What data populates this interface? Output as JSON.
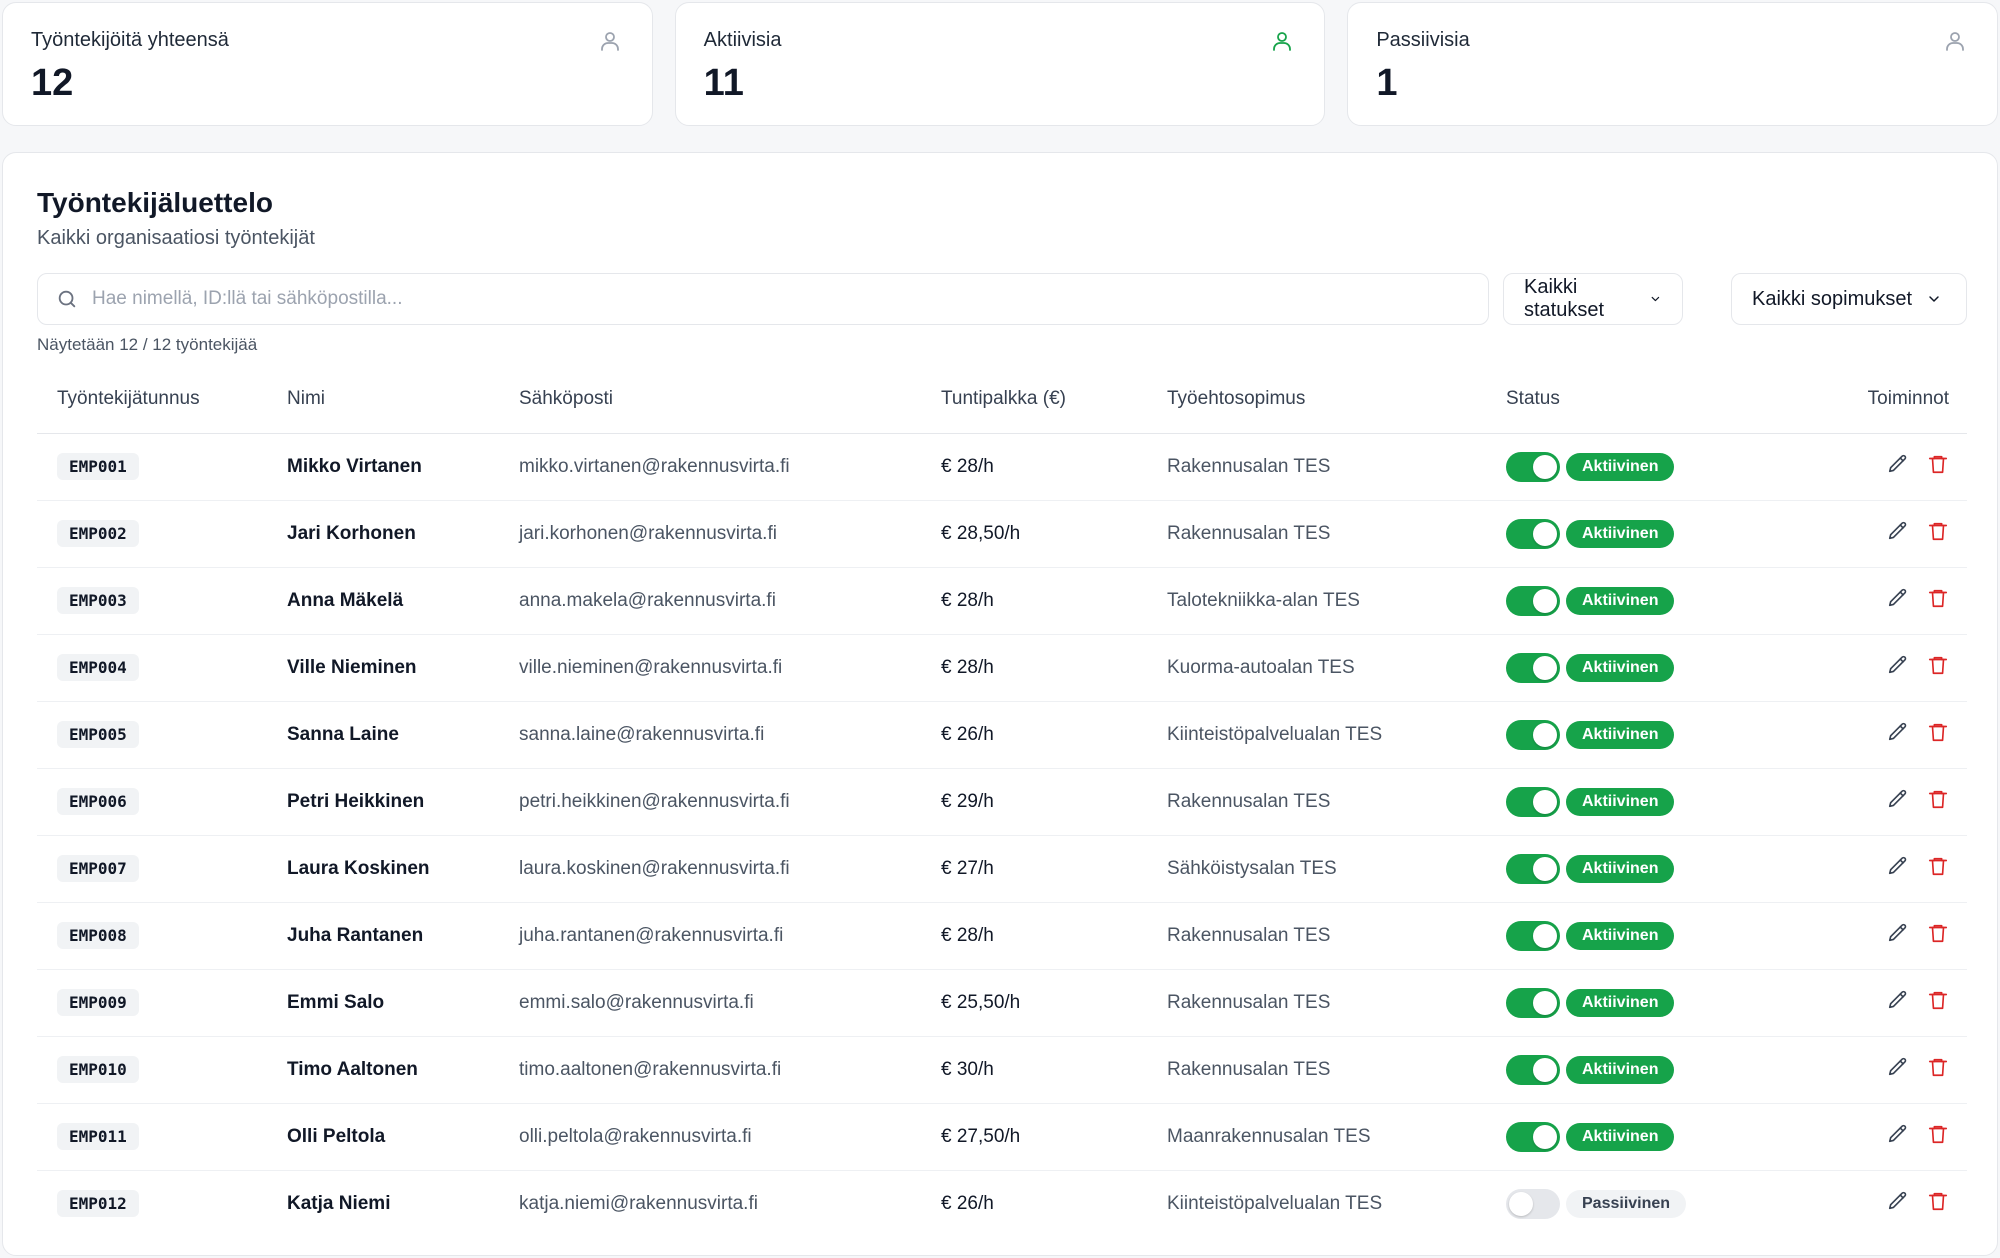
{
  "stats": [
    {
      "title": "Työntekijöitä yhteensä",
      "value": "12",
      "icon": "user-icon",
      "icon_color": "#9ca3af"
    },
    {
      "title": "Aktiivisia",
      "value": "11",
      "icon": "user-icon",
      "icon_color": "#16a34a"
    },
    {
      "title": "Passiivisia",
      "value": "1",
      "icon": "user-icon",
      "icon_color": "#9ca3af"
    }
  ],
  "panel": {
    "title": "Työntekijäluettelo",
    "subtitle": "Kaikki organisaatiosi työntekijät"
  },
  "search": {
    "placeholder": "Hae nimellä, ID:llä tai sähköpostilla...",
    "value": ""
  },
  "filters": {
    "status_label": "Kaikki statukset",
    "contract_label": "Kaikki sopimukset"
  },
  "count_text": "Näytetään 12 / 12 työntekijää",
  "columns": [
    "Työntekijätunnus",
    "Nimi",
    "Sähköposti",
    "Tuntipalkka (€)",
    "Työehtosopimus",
    "Status",
    "Toiminnot"
  ],
  "employees": [
    {
      "id": "EMP001",
      "name": "Mikko Virtanen",
      "email": "mikko.virtanen@rakennusvirta.fi",
      "wage": "€ 28/h",
      "tes": "Rakennusalan TES",
      "active": true,
      "status": "Aktiivinen"
    },
    {
      "id": "EMP002",
      "name": "Jari Korhonen",
      "email": "jari.korhonen@rakennusvirta.fi",
      "wage": "€ 28,50/h",
      "tes": "Rakennusalan TES",
      "active": true,
      "status": "Aktiivinen"
    },
    {
      "id": "EMP003",
      "name": "Anna Mäkelä",
      "email": "anna.makela@rakennusvirta.fi",
      "wage": "€ 28/h",
      "tes": "Talotekniikka-alan TES",
      "active": true,
      "status": "Aktiivinen"
    },
    {
      "id": "EMP004",
      "name": "Ville Nieminen",
      "email": "ville.nieminen@rakennusvirta.fi",
      "wage": "€ 28/h",
      "tes": "Kuorma-autoalan TES",
      "active": true,
      "status": "Aktiivinen"
    },
    {
      "id": "EMP005",
      "name": "Sanna Laine",
      "email": "sanna.laine@rakennusvirta.fi",
      "wage": "€ 26/h",
      "tes": "Kiinteistöpalvelualan TES",
      "active": true,
      "status": "Aktiivinen"
    },
    {
      "id": "EMP006",
      "name": "Petri Heikkinen",
      "email": "petri.heikkinen@rakennusvirta.fi",
      "wage": "€ 29/h",
      "tes": "Rakennusalan TES",
      "active": true,
      "status": "Aktiivinen"
    },
    {
      "id": "EMP007",
      "name": "Laura Koskinen",
      "email": "laura.koskinen@rakennusvirta.fi",
      "wage": "€ 27/h",
      "tes": "Sähköistysalan TES",
      "active": true,
      "status": "Aktiivinen"
    },
    {
      "id": "EMP008",
      "name": "Juha Rantanen",
      "email": "juha.rantanen@rakennusvirta.fi",
      "wage": "€ 28/h",
      "tes": "Rakennusalan TES",
      "active": true,
      "status": "Aktiivinen"
    },
    {
      "id": "EMP009",
      "name": "Emmi Salo",
      "email": "emmi.salo@rakennusvirta.fi",
      "wage": "€ 25,50/h",
      "tes": "Rakennusalan TES",
      "active": true,
      "status": "Aktiivinen"
    },
    {
      "id": "EMP010",
      "name": "Timo Aaltonen",
      "email": "timo.aaltonen@rakennusvirta.fi",
      "wage": "€ 30/h",
      "tes": "Rakennusalan TES",
      "active": true,
      "status": "Aktiivinen"
    },
    {
      "id": "EMP011",
      "name": "Olli Peltola",
      "email": "olli.peltola@rakennusvirta.fi",
      "wage": "€ 27,50/h",
      "tes": "Maanrakennusalan TES",
      "active": true,
      "status": "Aktiivinen"
    },
    {
      "id": "EMP012",
      "name": "Katja Niemi",
      "email": "katja.niemi@rakennusvirta.fi",
      "wage": "€ 26/h",
      "tes": "Kiinteistöpalvelualan TES",
      "active": false,
      "status": "Passiivinen"
    }
  ],
  "colors": {
    "active": "#16a34a",
    "delete": "#dc2626",
    "edit": "#374151"
  },
  "icons": {
    "edit": "pencil-icon",
    "delete": "trash-icon",
    "search": "search-icon",
    "dropdown": "chevron-down-icon"
  }
}
